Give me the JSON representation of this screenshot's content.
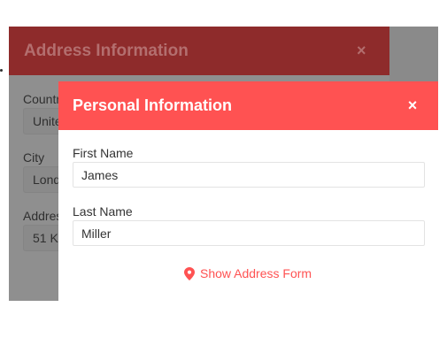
{
  "background_modal": {
    "title": "Address Information",
    "close_glyph": "×",
    "fields": [
      {
        "label": "Countr",
        "value": "Unite"
      },
      {
        "label": "City",
        "value": "Lond"
      },
      {
        "label": "Addres",
        "value": "51 K"
      }
    ]
  },
  "foreground_modal": {
    "title": "Personal Information",
    "close_glyph": "×",
    "first_name": {
      "label": "First Name",
      "value": "James"
    },
    "last_name": {
      "label": "Last Name",
      "value": "Miller"
    },
    "address_link": {
      "icon": "map-pin-icon",
      "text": "Show Address Form"
    }
  },
  "colors": {
    "accent": "#ff5252",
    "overlay": "#8f8f8f",
    "background_header": "#8e2b2b"
  }
}
